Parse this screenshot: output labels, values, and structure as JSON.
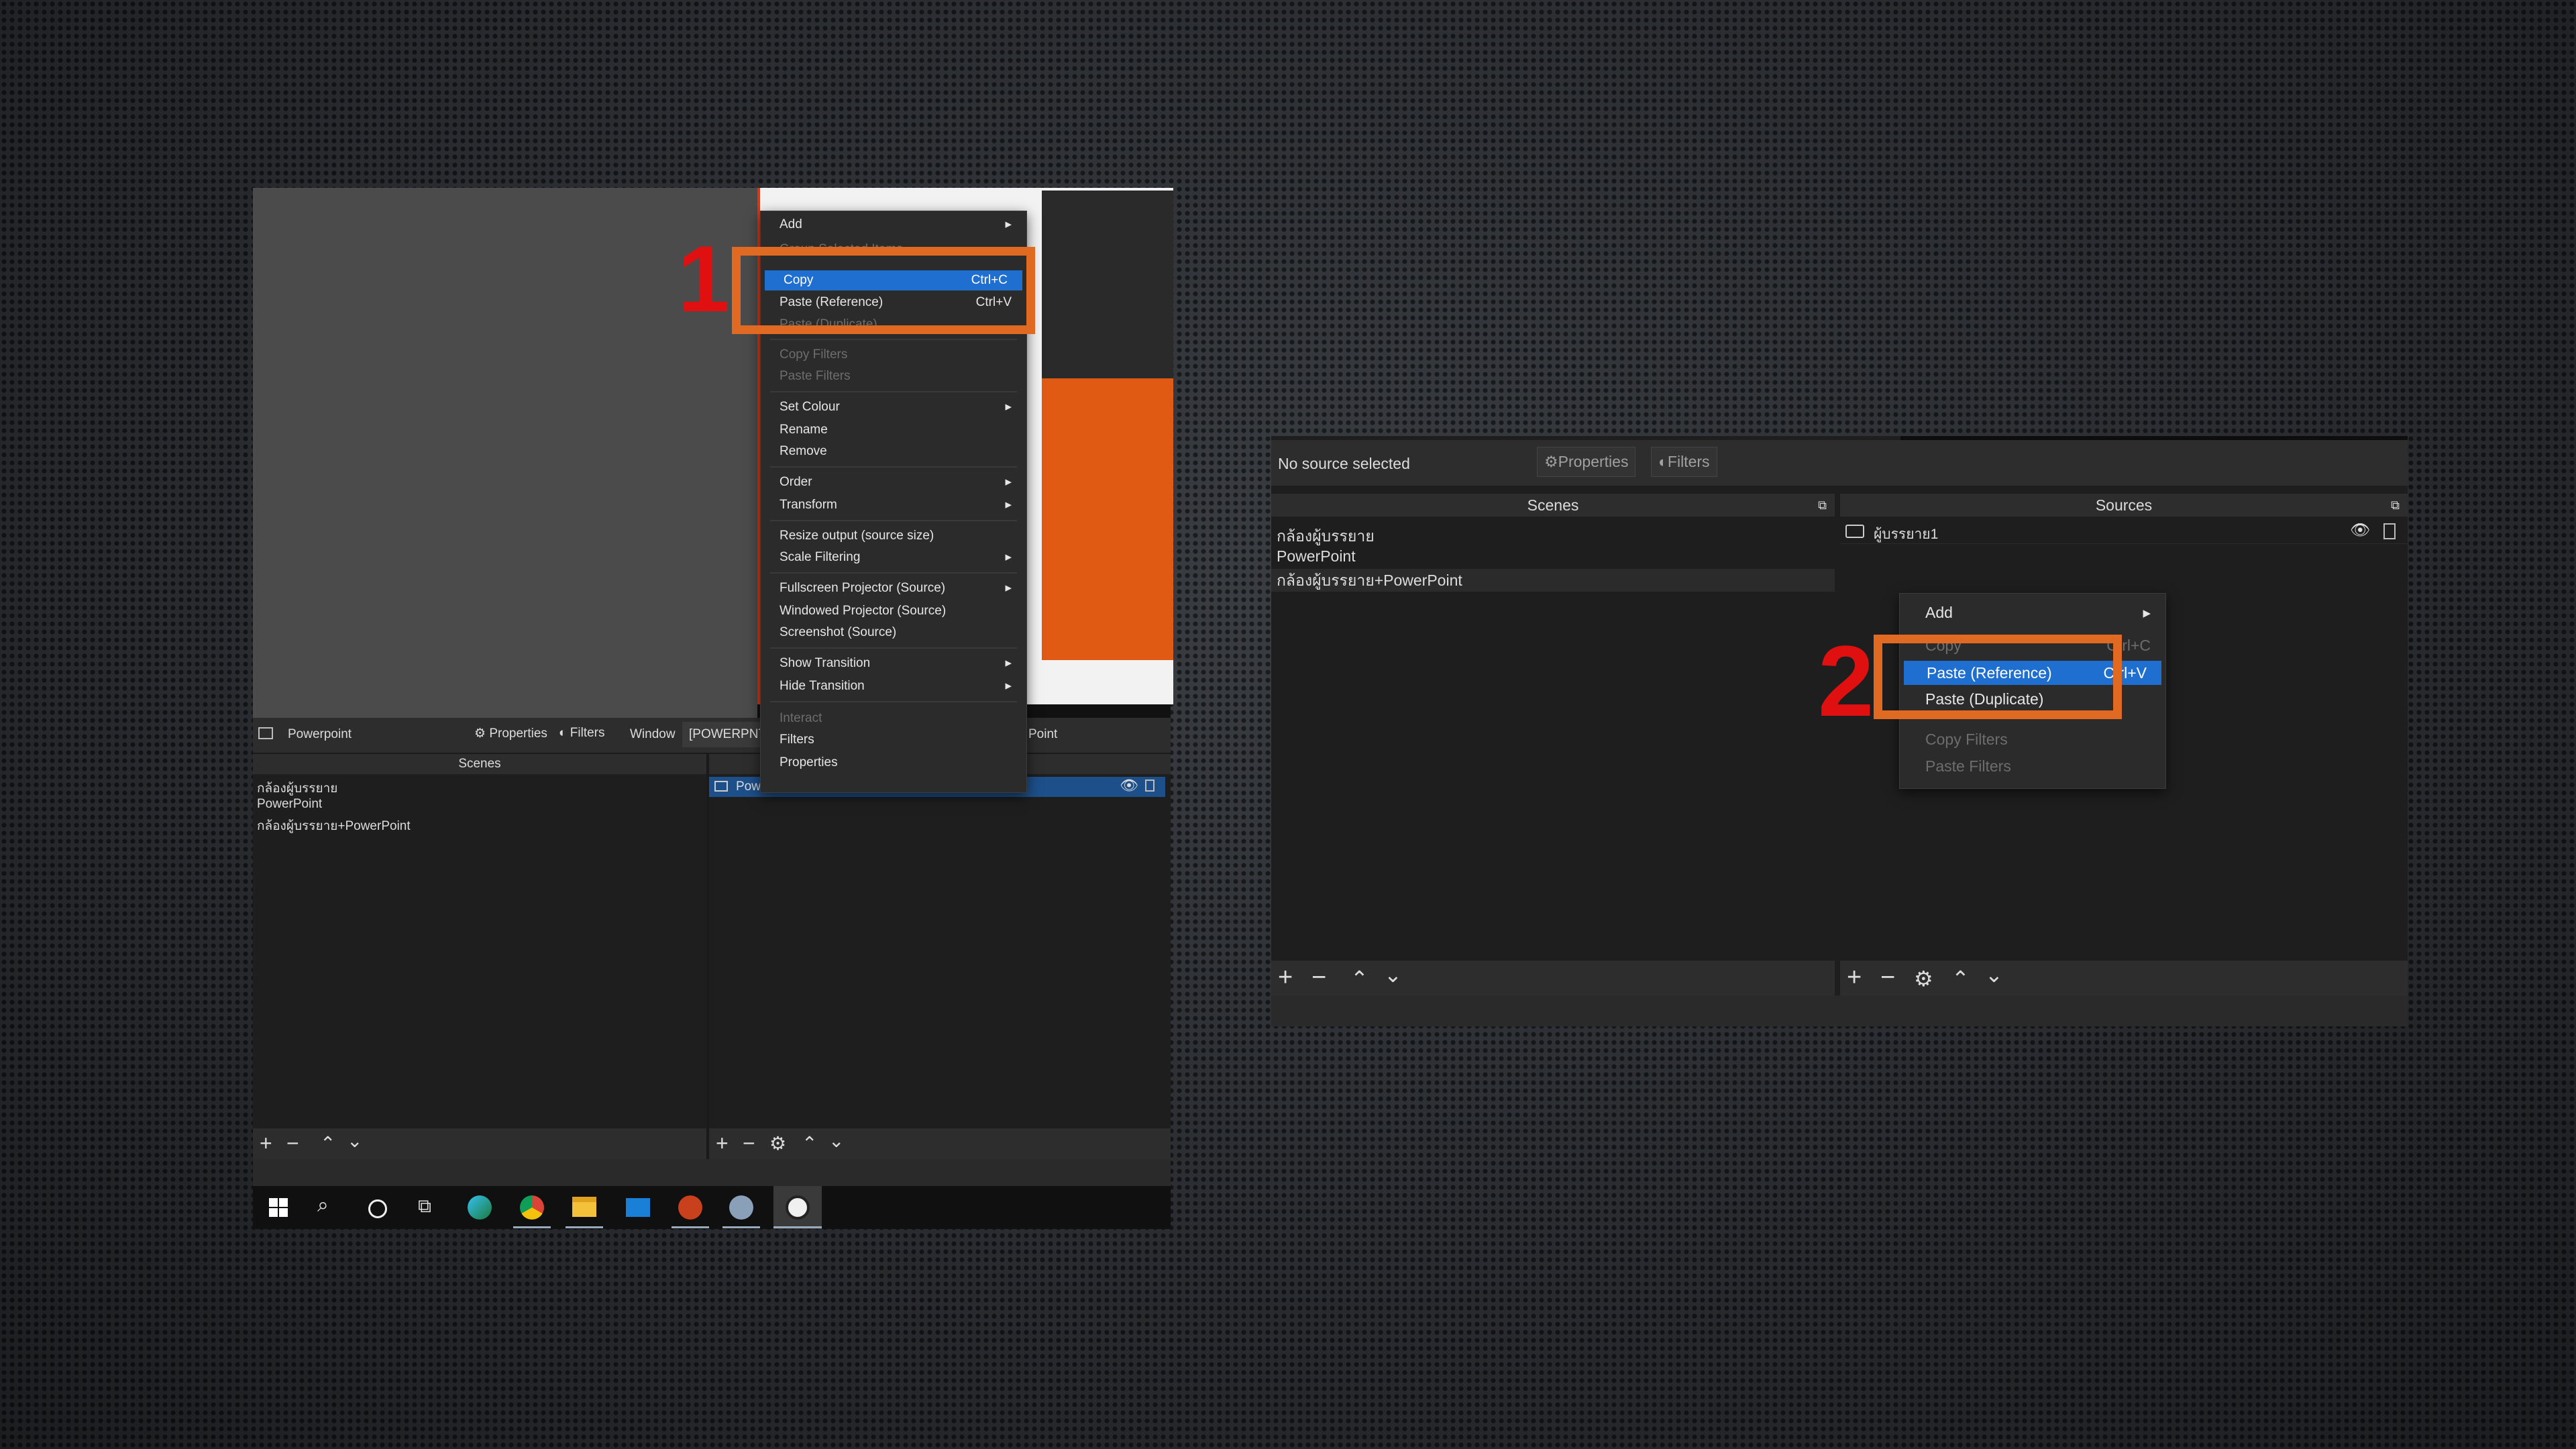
{
  "left": {
    "menu": {
      "items": [
        {
          "label": "Add",
          "arrow": true
        },
        {
          "label": "Group Selected Items",
          "disabled": true
        },
        {
          "label": "Copy",
          "shortcut": "Ctrl+C",
          "selected": true
        },
        {
          "label": "Paste (Reference)",
          "shortcut": "Ctrl+V"
        },
        {
          "label": "Paste (Duplicate)",
          "disabled": true
        },
        {
          "label": "Copy Filters",
          "disabled": true
        },
        {
          "label": "Paste Filters",
          "disabled": true
        },
        {
          "label": "Set Colour",
          "arrow": true
        },
        {
          "label": "Rename"
        },
        {
          "label": "Remove"
        },
        {
          "label": "Order",
          "arrow": true
        },
        {
          "label": "Transform",
          "arrow": true
        },
        {
          "label": "Resize output (source size)"
        },
        {
          "label": "Scale Filtering",
          "arrow": true
        },
        {
          "label": "Fullscreen Projector (Source)",
          "arrow": true
        },
        {
          "label": "Windowed Projector (Source)"
        },
        {
          "label": "Screenshot (Source)"
        },
        {
          "label": "Show Transition",
          "arrow": true
        },
        {
          "label": "Hide Transition",
          "arrow": true
        },
        {
          "label": "Interact",
          "disabled": true
        },
        {
          "label": "Filters"
        },
        {
          "label": "Properties"
        }
      ]
    },
    "toolbar": {
      "source_name": "Powerpoint",
      "properties": "Properties",
      "filters": "Filters",
      "window": "Window",
      "window_value": "[POWERPNT.E",
      "window_tail": "Point"
    },
    "scenes_header": "Scenes",
    "scenes": [
      "กล้องผู้บรรยาย",
      "PowerPoint",
      "กล้องผู้บรรยาย+PowerPoint"
    ],
    "source_item": "PowerPoint",
    "step": "1"
  },
  "right": {
    "status": "No source selected",
    "properties": "Properties",
    "filters": "Filters",
    "scenes_header": "Scenes",
    "sources_header": "Sources",
    "scenes": [
      "กล้องผู้บรรยาย",
      "PowerPoint",
      "กล้องผู้บรรยาย+PowerPoint"
    ],
    "source_item": "ผู้บรรยาย1",
    "menu": {
      "items": [
        {
          "label": "Add",
          "arrow": true
        },
        {
          "label": "Copy",
          "shortcut": "Ctrl+C",
          "disabled": true
        },
        {
          "label": "Paste (Reference)",
          "shortcut": "Ctrl+V",
          "selected": true
        },
        {
          "label": "Paste (Duplicate)"
        },
        {
          "label": "Copy Filters",
          "disabled": true
        },
        {
          "label": "Paste Filters",
          "disabled": true
        }
      ]
    },
    "step": "2"
  },
  "taskbar": {
    "icons": [
      "windows-start-icon",
      "search-icon",
      "cortana-icon",
      "task-view-icon",
      "edge-icon",
      "chrome-icon",
      "file-explorer-icon",
      "mail-icon",
      "powerpoint-icon",
      "app-icon",
      "obs-icon"
    ]
  },
  "colors": {
    "highlight": "#e06a22",
    "selected": "#1e6fd0",
    "step": "#e01010",
    "accent": "#e05a14"
  }
}
